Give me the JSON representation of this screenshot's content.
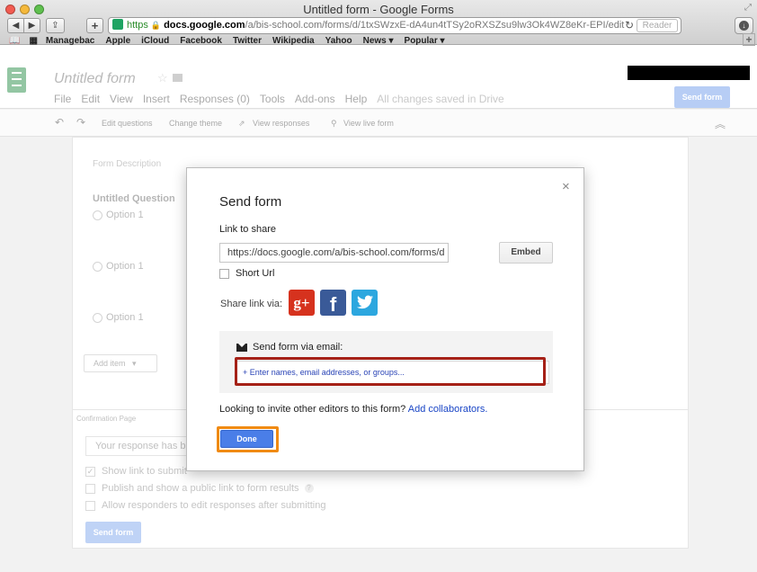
{
  "browser": {
    "window_title": "Untitled form - Google Forms",
    "url_scheme": "https",
    "url_host": "docs.google.com",
    "url_path": "/a/bis-school.com/forms/d/1txSWzxE-dA4un4tTSy2oRXSZsu9lw3Ok4WZ8eKr-EPI/edit",
    "reader_label": "Reader",
    "bookmarks": [
      "Managebac",
      "Apple",
      "iCloud",
      "Facebook",
      "Twitter",
      "Wikipedia",
      "Yahoo",
      "News ▾",
      "Popular ▾"
    ]
  },
  "app": {
    "doc_title": "Untitled form",
    "menu": [
      "File",
      "Edit",
      "View",
      "Insert",
      "Responses (0)",
      "Tools",
      "Add-ons",
      "Help"
    ],
    "save_status": "All changes saved in Drive",
    "send_form_label": "Send form",
    "toolbar": {
      "edit_questions": "Edit questions",
      "change_theme": "Change theme",
      "view_responses": "View responses",
      "view_live_form": "View live form"
    },
    "form_description": "Form Description",
    "question_title": "Untitled Question",
    "options": [
      "Option 1",
      "Option 1",
      "Option 1"
    ],
    "add_item_label": "Add item",
    "confirmation": {
      "label": "Confirmation Page",
      "input_value": "Your response has be",
      "opt_show_link": "Show link to submit",
      "opt_publish": "Publish and show a public link to form results",
      "opt_allow_edit": "Allow responders to edit responses after submitting",
      "send_form_label": "Send form"
    }
  },
  "modal": {
    "title": "Send form",
    "close_glyph": "×",
    "link_label": "Link to share",
    "link_value": "https://docs.google.com/a/bis-school.com/forms/d",
    "embed_label": "Embed",
    "short_url_label": "Short Url",
    "share_via_label": "Share link via:",
    "social": {
      "google_plus": "g+",
      "facebook": "f"
    },
    "email_label": "Send form via email:",
    "email_placeholder": "+ Enter names, email addresses, or groups...",
    "invite_text": "Looking to invite other editors to this form?",
    "invite_link": "Add collaborators.",
    "done_label": "Done"
  },
  "colors": {
    "accent_blue": "#4a7ee8",
    "highlight_red": "#a52117",
    "highlight_orange": "#f08a13"
  }
}
